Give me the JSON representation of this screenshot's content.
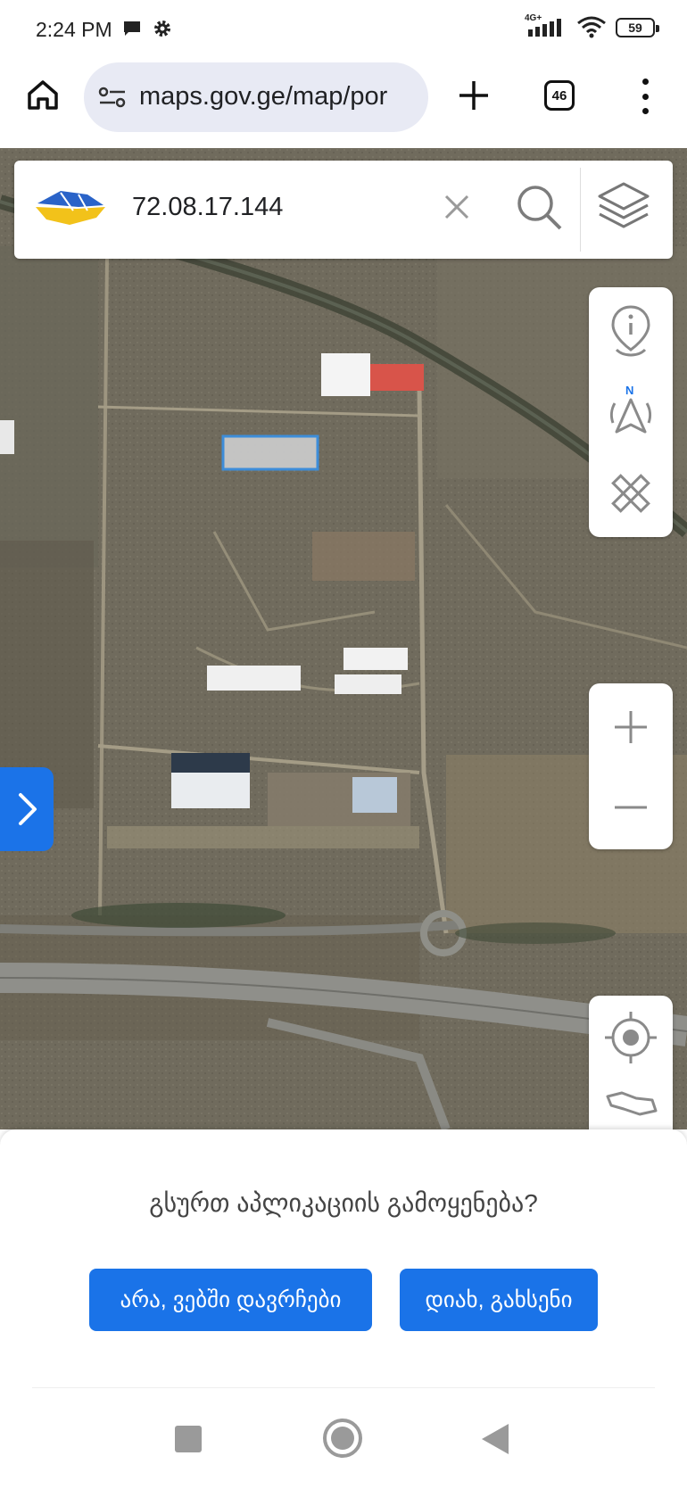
{
  "status_bar": {
    "time": "2:24 PM",
    "network": "4G+",
    "battery": "59"
  },
  "browser": {
    "url": "maps.gov.ge/map/por",
    "tab_count": "46"
  },
  "map_search": {
    "query": "72.08.17.144"
  },
  "dialog": {
    "question": "გსურთ აპლიკაციის გამოყენება?",
    "no_label": "არა, ვებში დავრჩები",
    "yes_label": "დიახ, გახსენი"
  },
  "colors": {
    "accent": "#1a73e8",
    "parcel_fill": "#c9c9c9",
    "parcel_border": "#3b8fe0"
  }
}
